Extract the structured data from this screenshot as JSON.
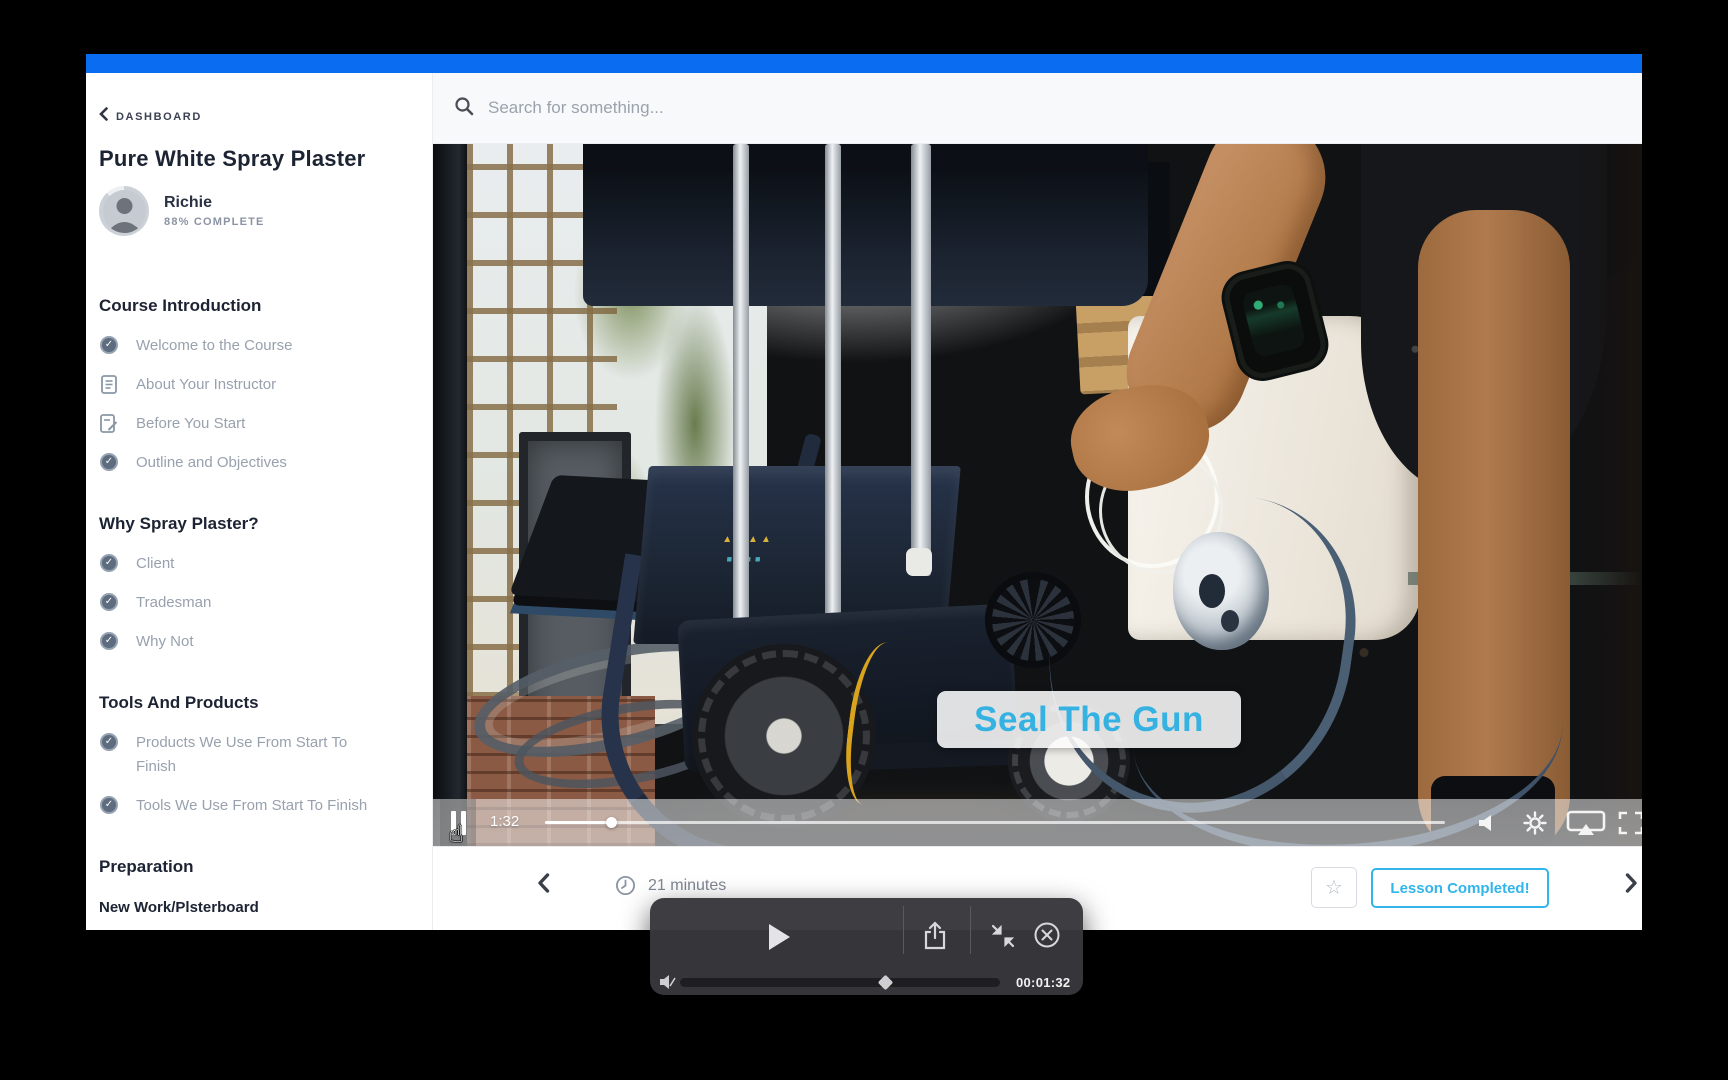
{
  "topbar": {
    "color": "#0a6cf1"
  },
  "sidebar": {
    "back_label": "DASHBOARD",
    "course_title": "Pure White Spray Plaster",
    "instructor": {
      "name": "Richie",
      "progress_label": "88% COMPLETE"
    },
    "sections": [
      {
        "title": "Course Introduction",
        "items": [
          {
            "label": "Welcome to the Course",
            "icon": "check-circle"
          },
          {
            "label": "About Your Instructor",
            "icon": "document"
          },
          {
            "label": "Before You Start",
            "icon": "document-edit"
          },
          {
            "label": "Outline and Objectives",
            "icon": "check-circle"
          }
        ]
      },
      {
        "title": "Why Spray Plaster?",
        "items": [
          {
            "label": "Client",
            "icon": "check-circle"
          },
          {
            "label": "Tradesman",
            "icon": "check-circle"
          },
          {
            "label": "Why Not",
            "icon": "check-circle"
          }
        ]
      },
      {
        "title": "Tools And Products",
        "items": [
          {
            "label": "Products We Use From Start To Finish",
            "icon": "check-circle"
          },
          {
            "label": "Tools We Use From Start To Finish",
            "icon": "check-circle"
          }
        ]
      },
      {
        "title": "Preparation",
        "items": []
      }
    ],
    "subheading": "New Work/Plsterboard"
  },
  "search": {
    "placeholder": "Search for something..."
  },
  "video": {
    "caption": "Seal The Gun",
    "controls": {
      "state": "playing",
      "current_time": "1:32",
      "progress_percent": 7.3,
      "icons": [
        "pause",
        "volume",
        "settings",
        "airplay",
        "fullscreen"
      ]
    }
  },
  "lesson_bar": {
    "duration": "21 minutes",
    "complete_button_label": "Lesson Completed!"
  },
  "pip": {
    "time": "00:01:32",
    "progress_percent": 64,
    "icons": [
      "play",
      "share",
      "minimize",
      "close",
      "mute"
    ]
  },
  "colors": {
    "topbar_blue": "#0a6cf1",
    "accent_cyan": "#31b5ea",
    "caption_cyan": "#35b2e2"
  }
}
